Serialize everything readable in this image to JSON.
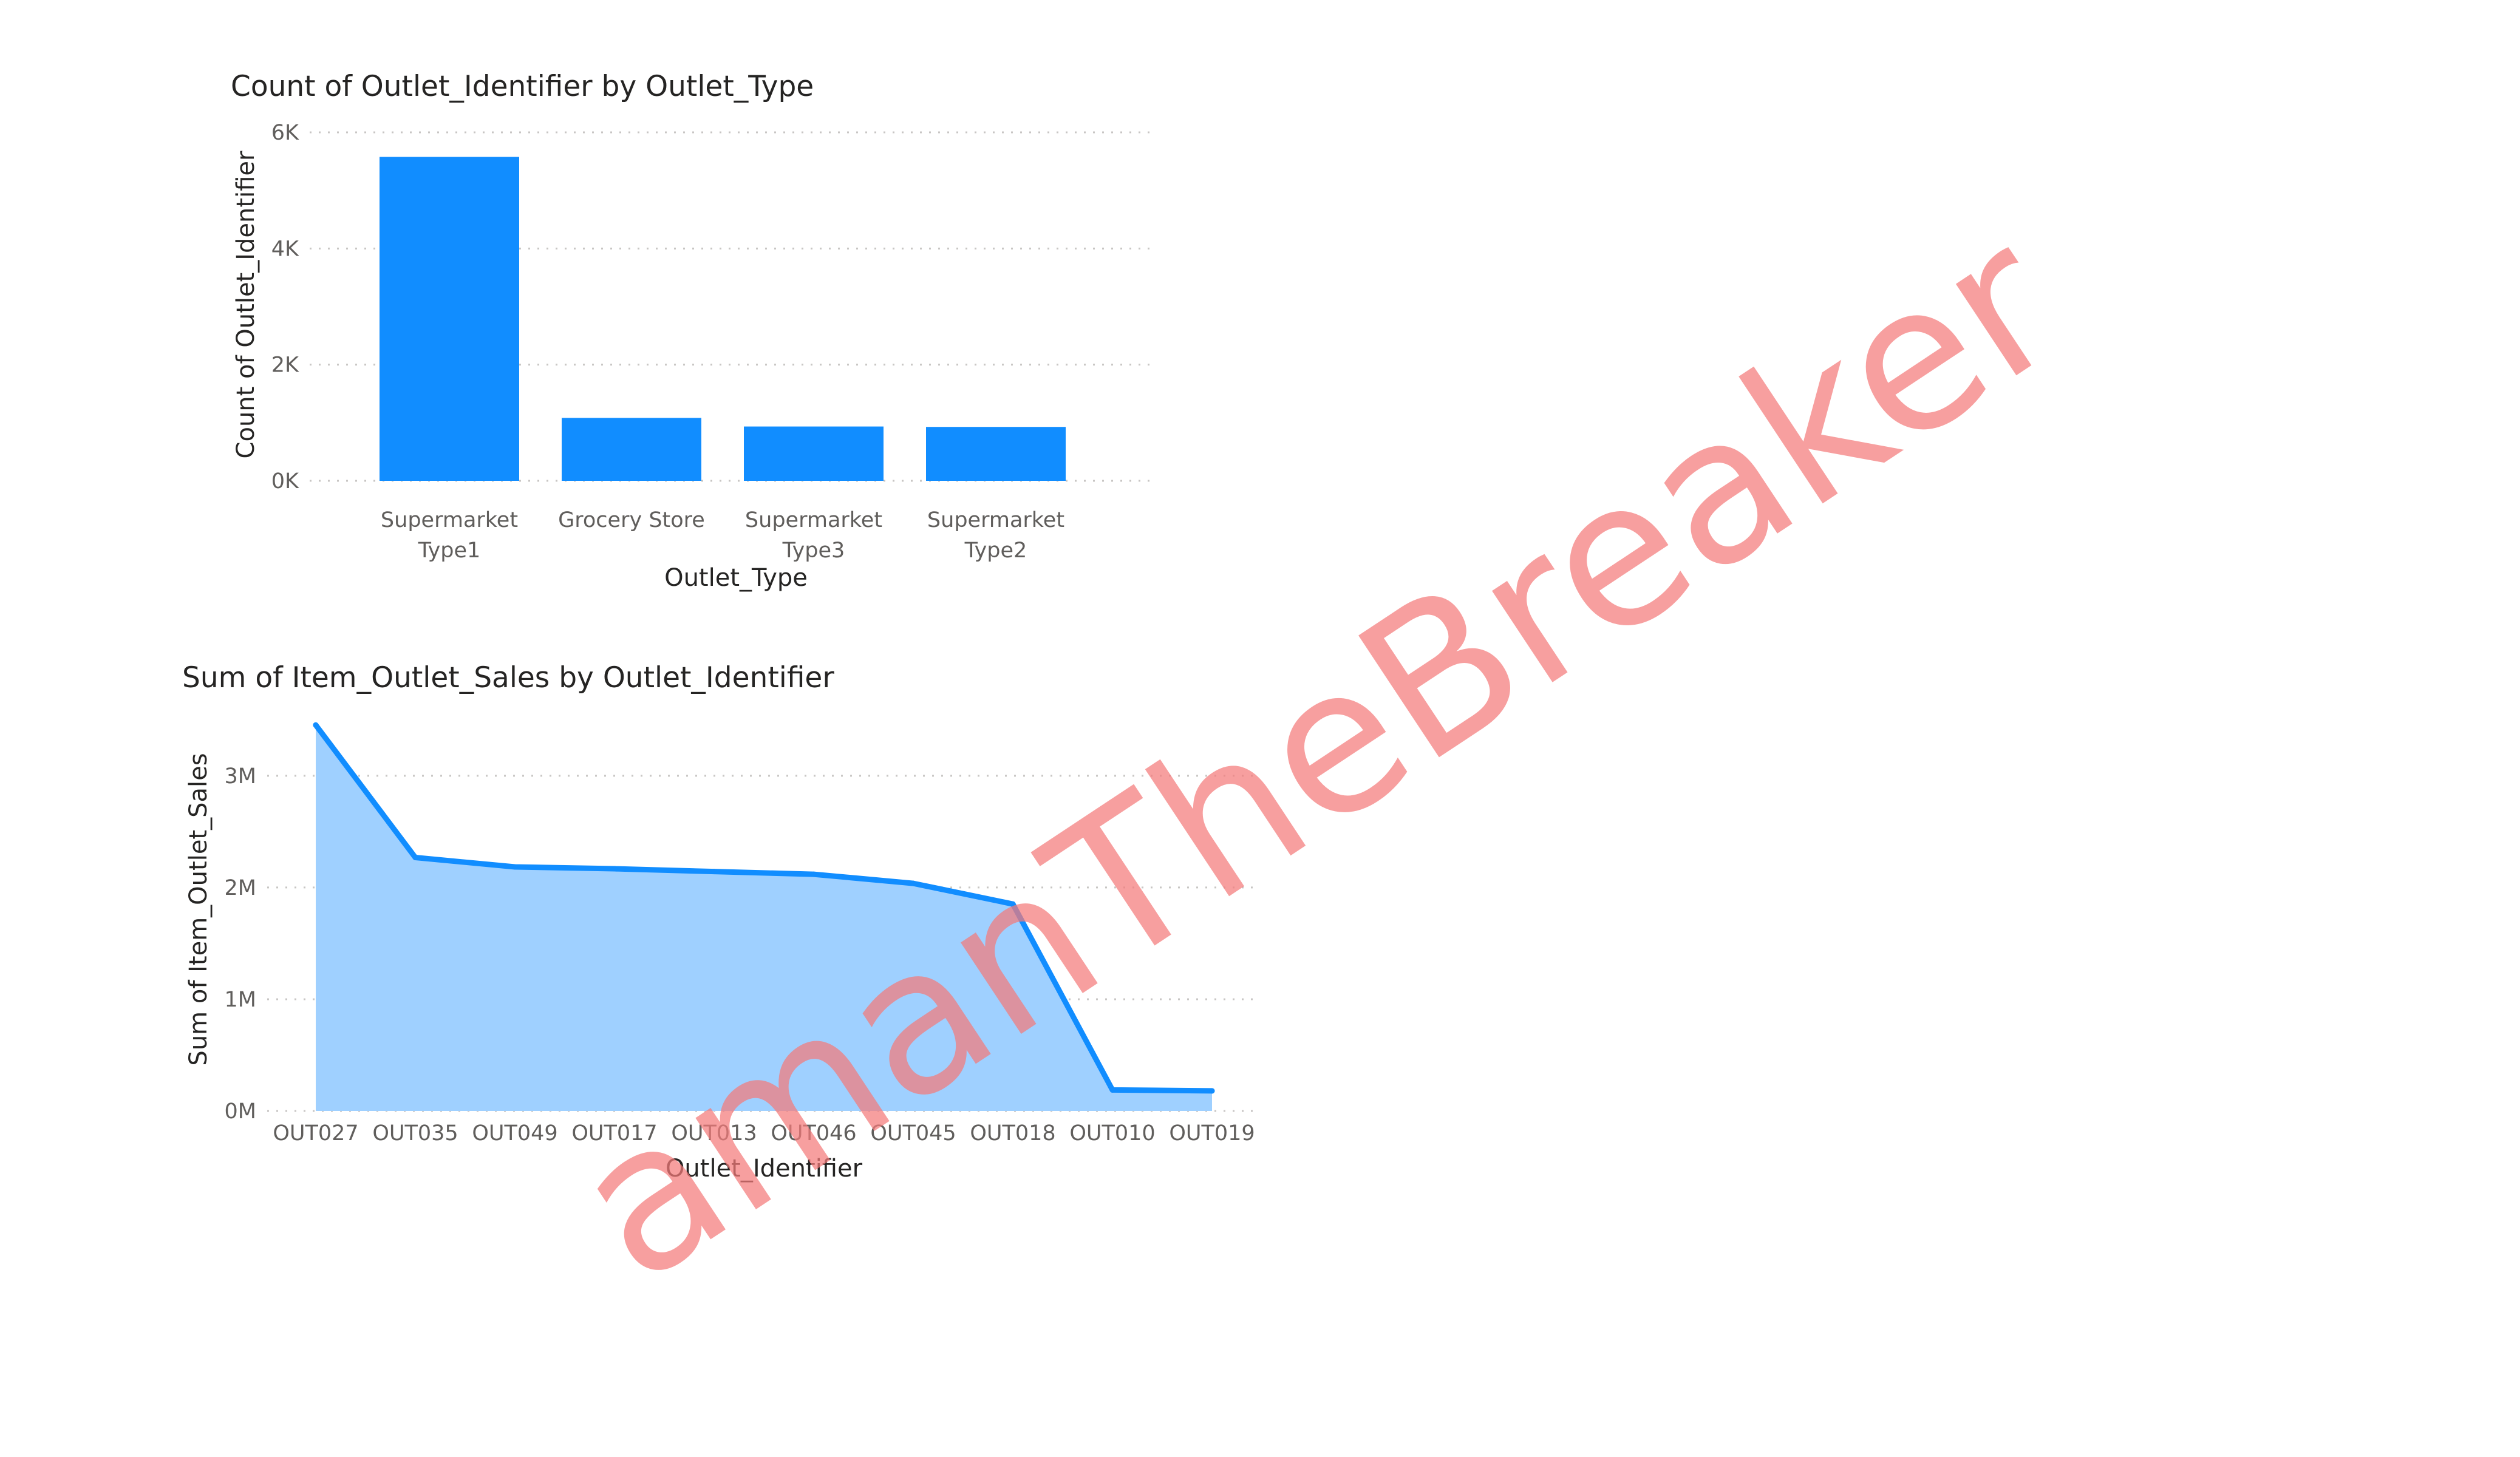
{
  "colors": {
    "bar": "#118dff",
    "line": "#118dff",
    "area": "#9fd0ff",
    "watermark": "#f47a7a"
  },
  "watermark": "amanTheBreaker",
  "chart_data": [
    {
      "type": "bar",
      "title": "Count of Outlet_Identifier by Outlet_Type",
      "xlabel": "Outlet_Type",
      "ylabel": "Count of Outlet_Identifier",
      "categories": [
        {
          "line1": "Supermarket",
          "line2": "Type1"
        },
        {
          "line1": "Grocery Store",
          "line2": ""
        },
        {
          "line1": "Supermarket",
          "line2": "Type3"
        },
        {
          "line1": "Supermarket",
          "line2": "Type2"
        }
      ],
      "values": [
        5577,
        1083,
        935,
        928
      ],
      "ylim": [
        0,
        6000
      ],
      "yticks": [
        {
          "value": 0,
          "label": "0K"
        },
        {
          "value": 2000,
          "label": "2K"
        },
        {
          "value": 4000,
          "label": "4K"
        },
        {
          "value": 6000,
          "label": "6K"
        }
      ],
      "grid": true,
      "legend": "none"
    },
    {
      "type": "area",
      "title": "Sum of Item_Outlet_Sales by Outlet_Identifier",
      "xlabel": "Outlet_Identifier",
      "ylabel": "Sum of Item_Outlet_Sales",
      "categories": [
        "OUT027",
        "OUT035",
        "OUT049",
        "OUT017",
        "OUT013",
        "OUT046",
        "OUT045",
        "OUT018",
        "OUT010",
        "OUT019"
      ],
      "values": [
        3453926,
        2268123,
        2183970,
        2167465,
        2142664,
        2118395,
        2036725,
        1851823,
        188340,
        179694
      ],
      "ylim": [
        0,
        3450000
      ],
      "yticks": [
        {
          "value": 0,
          "label": "0M"
        },
        {
          "value": 1000000,
          "label": "1M"
        },
        {
          "value": 2000000,
          "label": "2M"
        },
        {
          "value": 3000000,
          "label": "3M"
        }
      ],
      "grid": true,
      "legend": "none"
    }
  ]
}
